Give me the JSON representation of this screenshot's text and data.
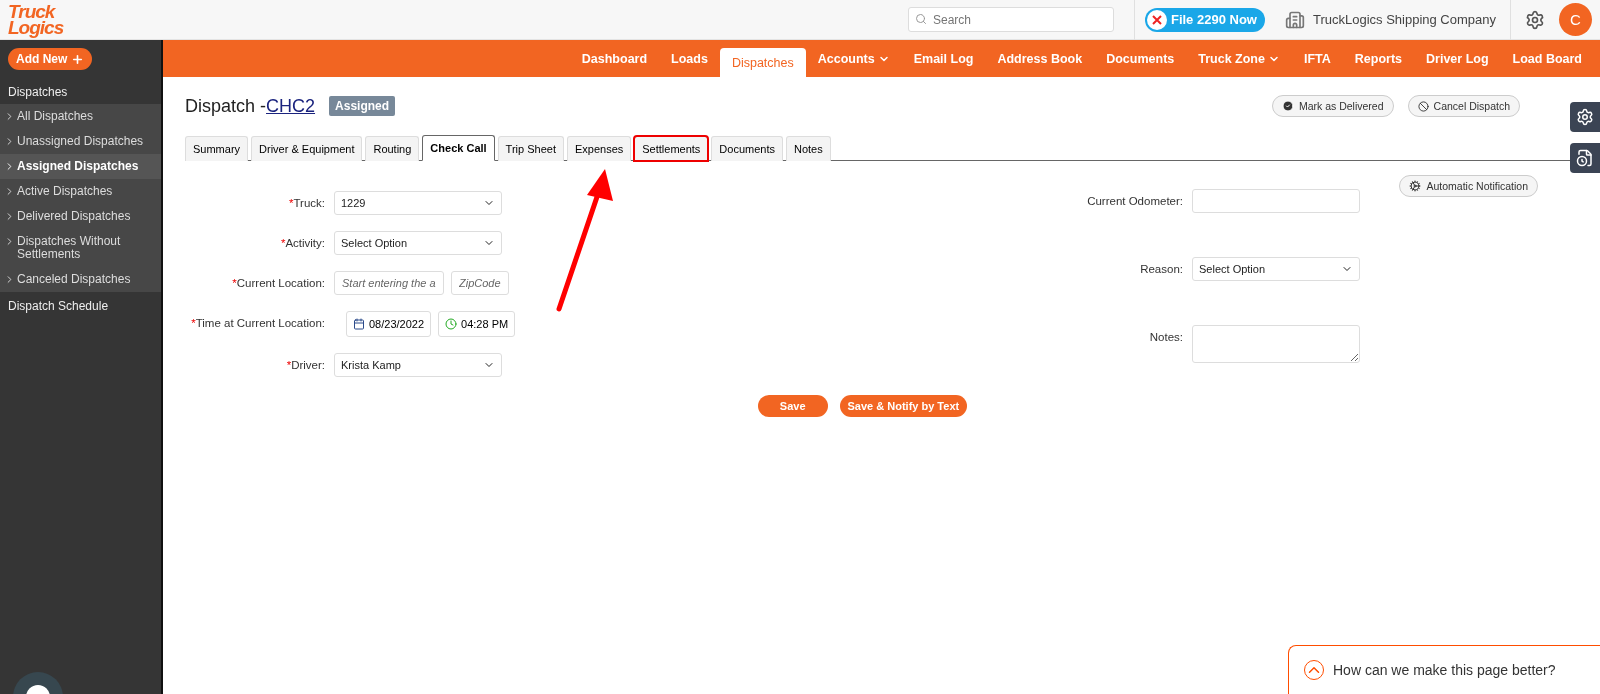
{
  "header": {
    "logo": [
      "Truck",
      "Logics"
    ],
    "search": {
      "placeholder": "Search"
    },
    "promo": "File 2290 Now",
    "company": "TruckLogics Shipping Company",
    "avatar": "C"
  },
  "nav": [
    {
      "label": "Dashboard",
      "selected": false,
      "dropdown": false
    },
    {
      "label": "Loads",
      "selected": false,
      "dropdown": false
    },
    {
      "label": "Dispatches",
      "selected": true,
      "dropdown": false
    },
    {
      "label": "Accounts",
      "selected": false,
      "dropdown": true
    },
    {
      "label": "Email Log",
      "selected": false,
      "dropdown": false
    },
    {
      "label": "Address Book",
      "selected": false,
      "dropdown": false
    },
    {
      "label": "Documents",
      "selected": false,
      "dropdown": false
    },
    {
      "label": "Truck Zone",
      "selected": false,
      "dropdown": true
    },
    {
      "label": "IFTA",
      "selected": false,
      "dropdown": false
    },
    {
      "label": "Reports",
      "selected": false,
      "dropdown": false
    },
    {
      "label": "Driver Log",
      "selected": false,
      "dropdown": false
    },
    {
      "label": "Load Board",
      "selected": false,
      "dropdown": false
    }
  ],
  "sidebar": {
    "add_new": "Add New",
    "sections": [
      {
        "title": "Dispatches",
        "items": [
          {
            "label": "All Dispatches",
            "selected": false
          },
          {
            "label": "Unassigned Dispatches",
            "selected": false
          },
          {
            "label": "Assigned Dispatches",
            "selected": true
          },
          {
            "label": "Active Dispatches",
            "selected": false
          },
          {
            "label": "Delivered Dispatches",
            "selected": false
          },
          {
            "label": "Dispatches Without Settlements",
            "selected": false
          },
          {
            "label": "Canceled Dispatches",
            "selected": false
          }
        ]
      },
      {
        "title": "Dispatch Schedule"
      }
    ]
  },
  "required_mark": "*",
  "page": {
    "title": "Dispatch - ",
    "code": "CHC2",
    "status": "Assigned",
    "actions": [
      "Mark as Delivered",
      "Cancel Dispatch"
    ]
  },
  "tabs": [
    {
      "label": "Summary",
      "selected": false,
      "highlighted": false
    },
    {
      "label": "Driver & Equipment",
      "selected": false,
      "highlighted": false
    },
    {
      "label": "Routing",
      "selected": false,
      "highlighted": false
    },
    {
      "label": "Check Call",
      "selected": true,
      "highlighted": false
    },
    {
      "label": "Trip Sheet",
      "selected": false,
      "highlighted": false
    },
    {
      "label": "Expenses",
      "selected": false,
      "highlighted": false
    },
    {
      "label": "Settlements",
      "selected": false,
      "highlighted": true
    },
    {
      "label": "Documents",
      "selected": false,
      "highlighted": false
    },
    {
      "label": "Notes",
      "selected": false,
      "highlighted": false
    }
  ],
  "auto_notification": "Automatic Notification",
  "left_form": [
    {
      "label": "Truck:",
      "required": true,
      "kind": "select",
      "value": "1229"
    },
    {
      "label": "Activity:",
      "required": true,
      "kind": "select",
      "value": "Select Option"
    },
    {
      "label": "Current Location:",
      "required": true,
      "kind": "location",
      "placeholder": "Start entering the a",
      "zip_placeholder": "ZipCode"
    },
    {
      "label": "Time at Current Location:",
      "required": true,
      "kind": "datetime",
      "date": "08/23/2022",
      "time": "04:28 PM"
    },
    {
      "label": "Driver:",
      "required": true,
      "kind": "select",
      "value": "Krista Kamp"
    }
  ],
  "right_form": [
    {
      "label": "Current Odometer:",
      "required": false,
      "kind": "text"
    },
    {
      "label": "Reason:",
      "required": false,
      "kind": "select",
      "value": "Select Option"
    },
    {
      "label": "Notes:",
      "required": false,
      "kind": "textarea"
    }
  ],
  "buttons": [
    "Save",
    "Save & Notify by Text"
  ],
  "feedback": "How can we make this page better?"
}
